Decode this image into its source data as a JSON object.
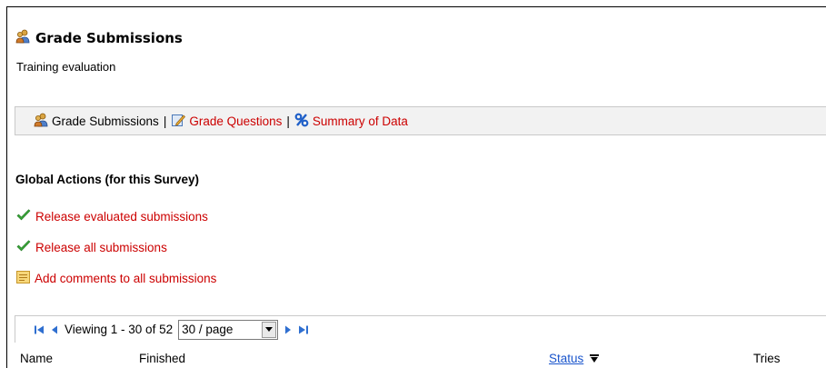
{
  "page": {
    "title": "Grade Submissions",
    "subtitle": "Training evaluation"
  },
  "toolbar": {
    "items": [
      {
        "label": "Grade Submissions",
        "icon": "users-icon"
      },
      {
        "label": "Grade Questions",
        "icon": "edit-icon"
      },
      {
        "label": "Summary of Data",
        "icon": "percent-icon"
      }
    ],
    "separator": "|"
  },
  "global_actions": {
    "title": "Global Actions (for this Survey)",
    "items": [
      {
        "label": "Release evaluated submissions",
        "icon": "checkmark-icon"
      },
      {
        "label": "Release all submissions",
        "icon": "checkmark-icon"
      },
      {
        "label": "Add comments to all submissions",
        "icon": "comment-icon"
      }
    ]
  },
  "pager": {
    "viewing": "Viewing 1 - 30 of 52",
    "per_page": "30 / page"
  },
  "table": {
    "columns": [
      "Name",
      "Finished",
      "Status",
      "Tries"
    ]
  },
  "colors": {
    "link": "#cc0000",
    "sort_link": "#1a55cc",
    "pager_icon": "#2f6fd0",
    "check": "#3aa63a"
  }
}
